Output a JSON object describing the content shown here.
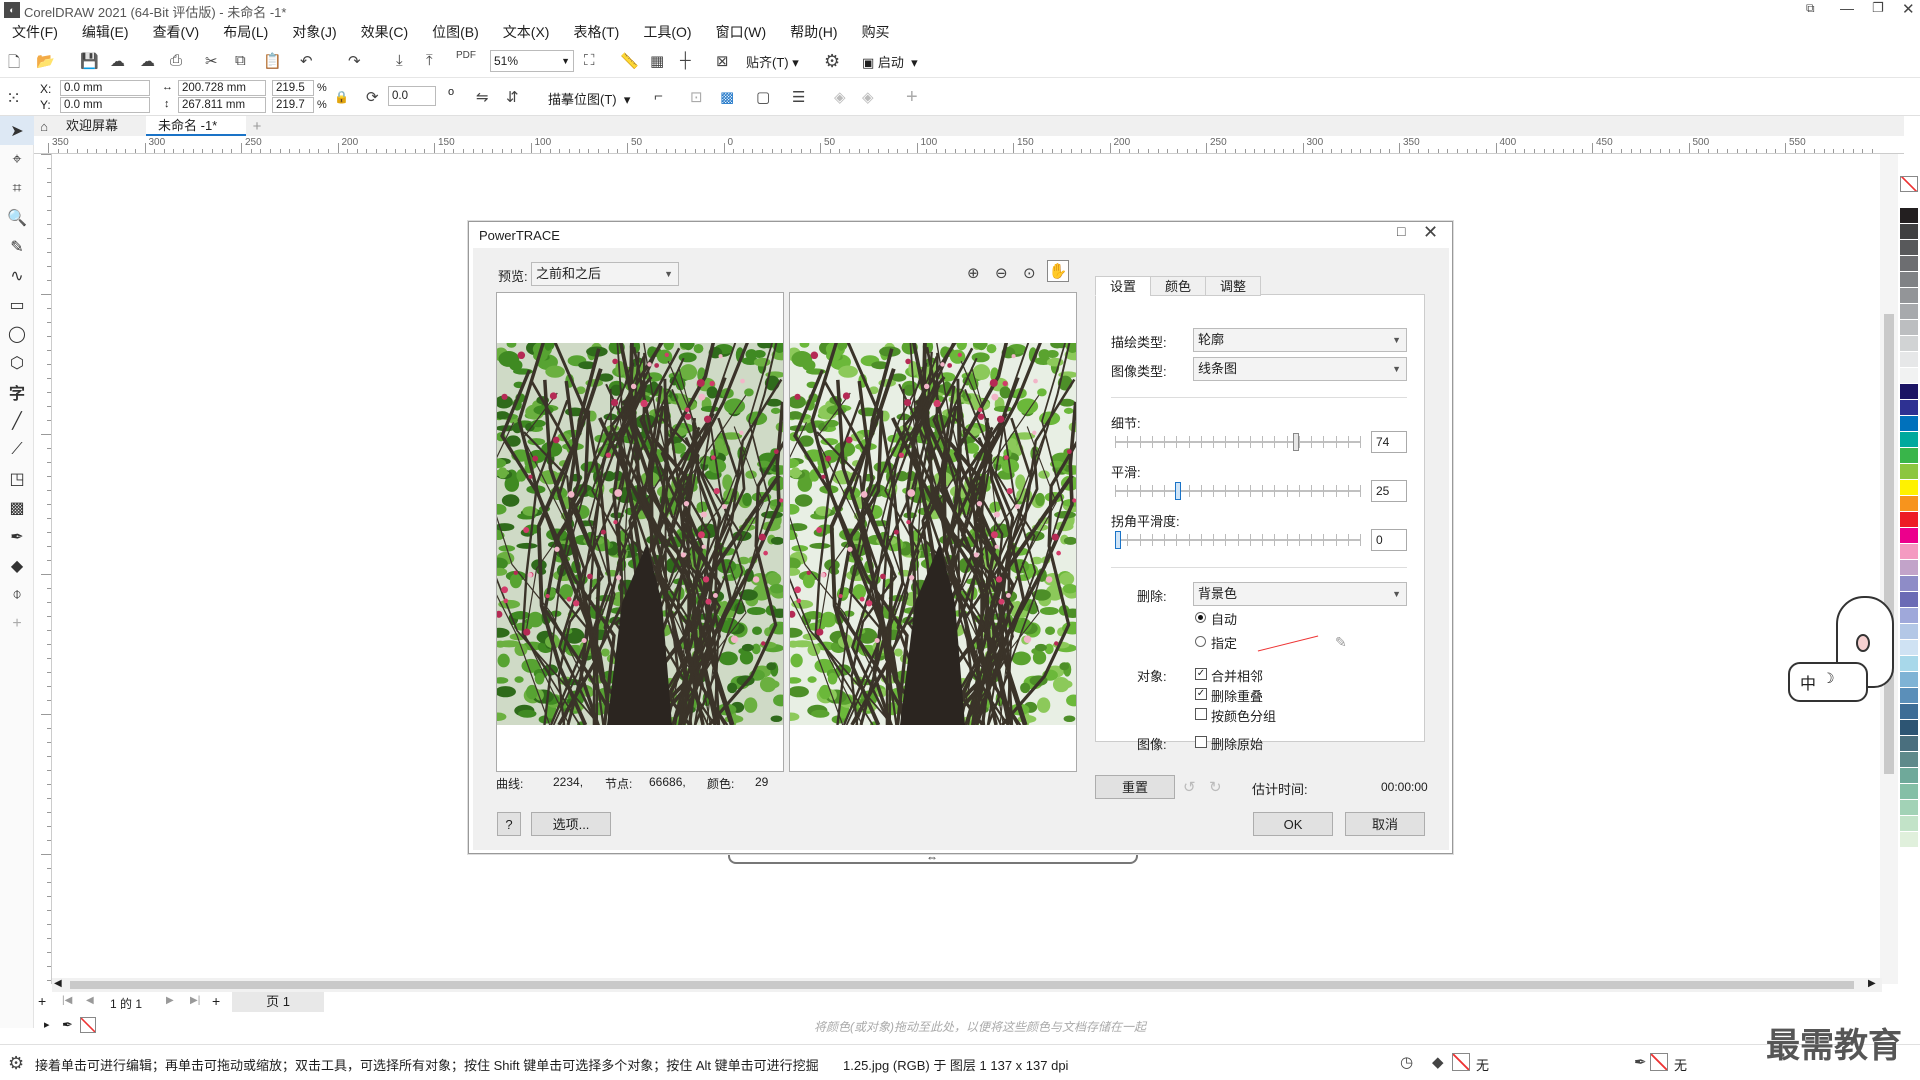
{
  "window": {
    "title": "CorelDRAW 2021 (64-Bit 评估版) - 未命名 -1*"
  },
  "menu": [
    "文件(F)",
    "编辑(E)",
    "查看(V)",
    "布局(L)",
    "对象(J)",
    "效果(C)",
    "位图(B)",
    "文本(X)",
    "表格(T)",
    "工具(O)",
    "窗口(W)",
    "帮助(H)",
    "购买"
  ],
  "toolbar": {
    "zoom": "51%",
    "snap_label": "贴齐(T)",
    "launch_label": "启动"
  },
  "property_bar": {
    "x_label": "X:",
    "x_value": "0.0 mm",
    "y_label": "Y:",
    "y_value": "0.0 mm",
    "width": "200.728 mm",
    "height": "267.811 mm",
    "scale_w": "219.5",
    "scale_h": "219.7",
    "percent": "%",
    "rotation": "0.0",
    "trace_label": "描摹位图(T)"
  },
  "tabs": {
    "welcome": "欢迎屏幕",
    "doc": "未命名 -1*"
  },
  "ruler_ticks": [
    "350",
    "300",
    "250",
    "200",
    "150",
    "100",
    "50",
    "0",
    "50",
    "100",
    "150",
    "200",
    "250",
    "300",
    "350",
    "400",
    "450",
    "500",
    "550"
  ],
  "dialog": {
    "title": "PowerTRACE",
    "preview_label": "预览:",
    "preview_value": "之前和之后",
    "tabs": [
      "设置",
      "颜色",
      "调整"
    ],
    "trace_type_label": "描绘类型:",
    "trace_type_value": "轮廓",
    "image_type_label": "图像类型:",
    "image_type_value": "线条图",
    "detail_label": "细节:",
    "detail_value": "74",
    "smooth_label": "平滑:",
    "smooth_value": "25",
    "corner_label": "拐角平滑度:",
    "corner_value": "0",
    "levels": {
      "detail": 0.74,
      "smooth": 0.25,
      "corner": 0.0
    },
    "remove_label": "删除:",
    "remove_value": "背景色",
    "auto_label": "自动",
    "specify_label": "指定",
    "objects_label": "对象:",
    "merge_label": "合并相邻",
    "remove_overlap_label": "删除重叠",
    "group_label": "按颜色分组",
    "image_label": "图像:",
    "remove_original_label": "删除原始",
    "curves_label": "曲线:",
    "curves_value": "2234,",
    "nodes_label": "节点:",
    "nodes_value": "66686,",
    "colors_label": "颜色:",
    "colors_value": "29",
    "reset_label": "重置",
    "time_label": "估计时间:",
    "time_value": "00:00:00",
    "help_label": "?",
    "options_label": "选项...",
    "ok_label": "OK",
    "cancel_label": "取消"
  },
  "pages": {
    "current": "1",
    "of_label": "的",
    "total": "1",
    "page_tab": "页 1"
  },
  "docbar_hint": "将颜色(或对象)拖动至此处，以便将这些颜色与文档存储在一起",
  "status": {
    "hint": "接着单击可进行编辑；再单击可拖动或缩放；双击工具，可选择所有对象；按住 Shift 键单击可选择多个对象；按住 Alt 键单击可进行挖掘",
    "file": "1.25.jpg (RGB) 于 图层 1 137 x 137 dpi",
    "fill": "无",
    "outline": "无"
  },
  "watermark": "最需教育",
  "ime": "中",
  "colors": {
    "accent": "#1a73c7",
    "leaf": "#4f9a2e",
    "branch": "#3a3329"
  }
}
